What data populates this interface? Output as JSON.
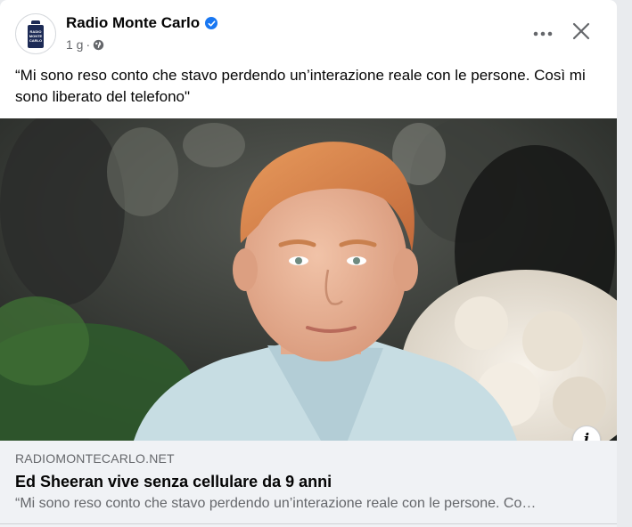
{
  "post": {
    "page_name": "Radio Monte Carlo",
    "time": "1 g",
    "time_separator": "·",
    "text": "“Mi sono reso conto che stavo perdendo un’interazione reale con le persone. Così mi sono liberato del telefono\"",
    "avatar_logo_text": "RADIO MONTE CARLO"
  },
  "actions": {
    "more_icon": "more-horizontal-icon",
    "close_icon": "close-icon"
  },
  "link_preview": {
    "domain": "RADIOMONTECARLO.NET",
    "title": "Ed Sheeran vive senza cellulare da 9 anni",
    "description": "“Mi sono reso conto che stavo perdendo un’interazione reale con le persone. Co…",
    "info_label": "i"
  },
  "colors": {
    "verified": "#1877f2",
    "preview_bg": "#f0f2f5",
    "secondary_text": "#65676b"
  }
}
